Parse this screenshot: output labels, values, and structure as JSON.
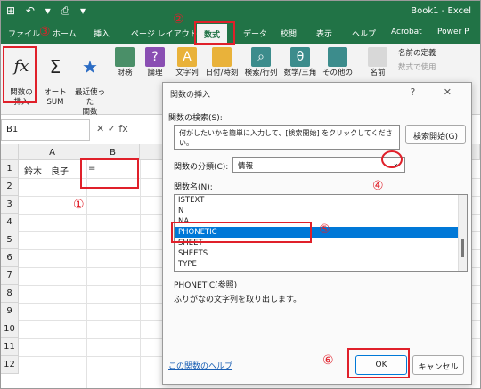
{
  "titlebar": {
    "qat": "⊞ ↶ ▾ ⎙ ▾",
    "document": "Book1 - Excel"
  },
  "tabs": [
    "ファイル",
    "ホーム",
    "挿入",
    "ページ レイアウト",
    "数式",
    "データ",
    "校閲",
    "表示",
    "ヘルプ",
    "Acrobat",
    "Power P"
  ],
  "ribbon": {
    "insert_function": "関数の\n挿入",
    "autosum": "オート\nSUM",
    "recent": "最近使った\n関数",
    "financial": "財務",
    "logical": "論理",
    "text": "文字列",
    "datetime": "日付/時刻",
    "lookup": "検索/行列",
    "math": "数学/三角",
    "more": "その他の",
    "names": "名前",
    "define_name": "名前の定義",
    "use_in_formula": "数式で使用"
  },
  "namebox": "B1",
  "fx_symbols": "✕  ✓  fx",
  "columns": [
    "A",
    "B"
  ],
  "rows": [
    "1",
    "2",
    "3",
    "4",
    "5",
    "6",
    "7",
    "8",
    "9",
    "10",
    "11",
    "12"
  ],
  "cells": {
    "A1": "鈴木　良子",
    "B1": "="
  },
  "markers": {
    "m1": "①",
    "m2": "②",
    "m3": "③",
    "m4": "④",
    "m5": "⑤",
    "m6": "⑥"
  },
  "dialog": {
    "title": "関数の挿入",
    "controls": "? ✕",
    "search_label": "関数の検索(S):",
    "search_value": "何がしたいかを簡単に入力して、[検索開始] をクリックしてください。",
    "search_button": "検索開始(G)",
    "category_label": "関数の分類(C):",
    "category_value": "情報",
    "name_label": "関数名(N):",
    "functions": [
      "ISTEXT",
      "N",
      "NA",
      "PHONETIC",
      "SHEET",
      "SHEETS",
      "TYPE"
    ],
    "selected": "PHONETIC",
    "signature": "PHONETIC(参照)",
    "description": "ふりがなの文字列を取り出します。",
    "help_link": "この関数のヘルプ",
    "ok": "OK",
    "cancel": "キャンセル"
  }
}
